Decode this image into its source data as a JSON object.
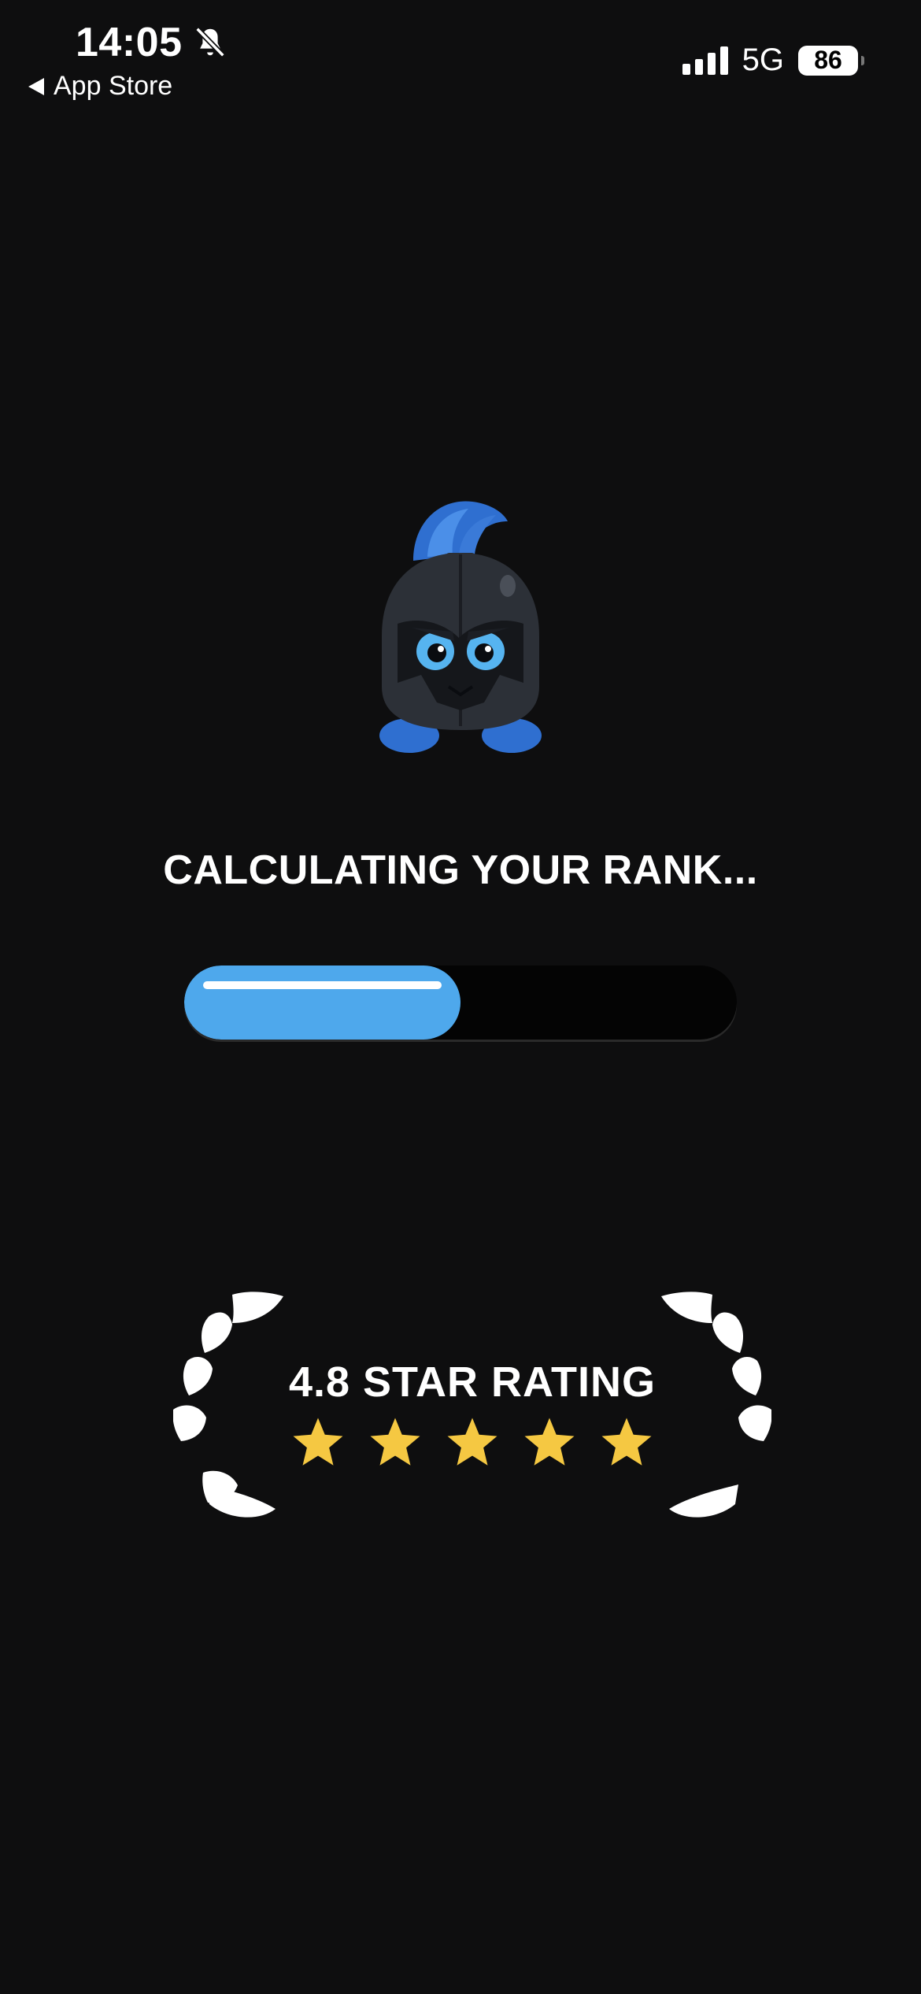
{
  "status_bar": {
    "time": "14:05",
    "back_label": "App Store",
    "network": "5G",
    "battery": "86"
  },
  "screen": {
    "headline": "CALCULATING YOUR RANK...",
    "progress_fraction": 0.5,
    "rating_text": "4.8 STAR RATING",
    "star_count": 5
  },
  "colors": {
    "background": "#0e0e0f",
    "accent": "#4ea8ec",
    "star": "#f5c842"
  },
  "icons": {
    "bell": "bell-slash-icon",
    "back": "back-triangle-icon",
    "mascot": "knight-helmet-mascot",
    "laurel": "laurel-wreath-icon",
    "star": "star-icon"
  }
}
